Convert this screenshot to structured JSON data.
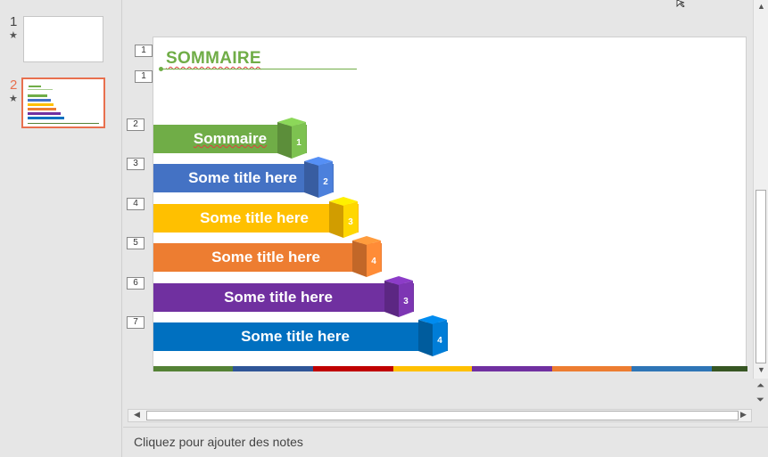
{
  "thumbnails": [
    {
      "number": "1",
      "star": "★"
    },
    {
      "number": "2",
      "star": "★",
      "active": true
    }
  ],
  "slide": {
    "title": "SOMMAIRE",
    "outline_levels": [
      "1",
      "1",
      "2",
      "3",
      "4",
      "5",
      "6",
      "7"
    ],
    "items": [
      {
        "label": "Sommaire",
        "number": "1",
        "color": "#70ad47"
      },
      {
        "label": "Some title here",
        "number": "2",
        "color": "#4472c4"
      },
      {
        "label": "Some title here",
        "number": "3",
        "color": "#ffc000"
      },
      {
        "label": "Some title here",
        "number": "4",
        "color": "#ed7d31"
      },
      {
        "label": "Some title here",
        "number": "3",
        "color": "#7030a0"
      },
      {
        "label": "Some title here",
        "number": "4",
        "color": "#0070c0"
      }
    ],
    "strip_colors": [
      "#548235",
      "#2f5597",
      "#c00000",
      "#ffc000",
      "#7030a0",
      "#ed7d31",
      "#2e75b6",
      "#375623"
    ]
  },
  "notes": {
    "placeholder": "Cliquez pour ajouter des notes"
  },
  "scroll": {
    "up": "▲",
    "down": "▼",
    "left": "◀",
    "right": "▶",
    "prev": "⏶",
    "next": "⏷"
  }
}
